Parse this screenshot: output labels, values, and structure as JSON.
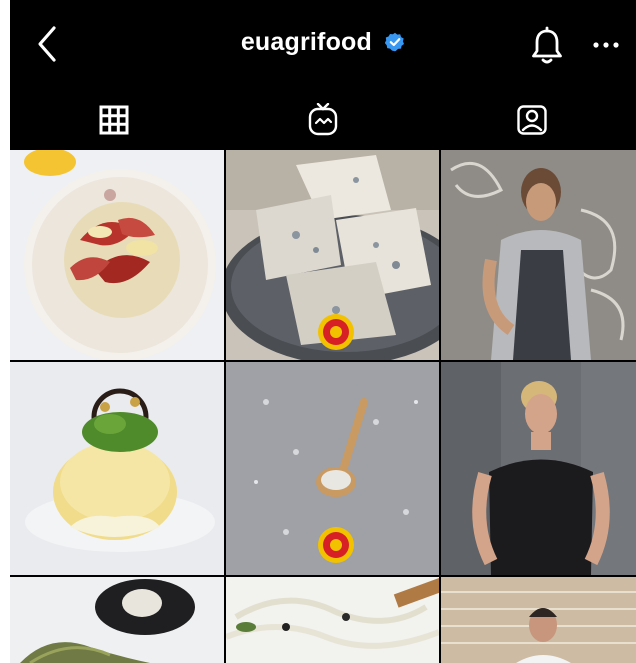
{
  "header": {
    "username": "euagrifood",
    "verified": true,
    "icons": [
      "back-arrow-icon",
      "verified-badge-icon",
      "bell-icon",
      "more-options-icon"
    ]
  },
  "tabs": {
    "items": [
      "grid-tab",
      "igtv-tab",
      "tagged-tab"
    ],
    "active": "grid-tab"
  },
  "colors": {
    "background": "#000000",
    "icon": "#ffffff",
    "verified": "#3897f0",
    "seal": "#d71f26",
    "seal_ring": "#f2c200"
  }
}
